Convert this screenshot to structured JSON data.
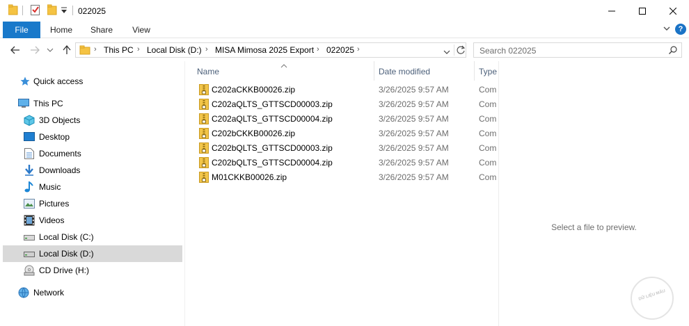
{
  "window": {
    "title": "022025",
    "controls": [
      "minimize",
      "maximize",
      "close"
    ]
  },
  "ribbon": {
    "tabs": [
      "File",
      "Home",
      "Share",
      "View"
    ]
  },
  "address": {
    "crumbs": [
      "This PC",
      "Local Disk (D:)",
      "MISA Mimosa 2025 Export",
      "022025"
    ]
  },
  "search": {
    "placeholder": "Search 022025"
  },
  "nav": {
    "items": [
      {
        "label": "Quick access",
        "icon": "star-icon"
      },
      {
        "label": "This PC",
        "icon": "computer-icon"
      },
      {
        "label": "3D Objects",
        "icon": "3d-objects-icon"
      },
      {
        "label": "Desktop",
        "icon": "desktop-icon"
      },
      {
        "label": "Documents",
        "icon": "documents-icon"
      },
      {
        "label": "Downloads",
        "icon": "downloads-icon"
      },
      {
        "label": "Music",
        "icon": "music-icon"
      },
      {
        "label": "Pictures",
        "icon": "pictures-icon"
      },
      {
        "label": "Videos",
        "icon": "videos-icon"
      },
      {
        "label": "Local Disk (C:)",
        "icon": "drive-icon"
      },
      {
        "label": "Local Disk (D:)",
        "icon": "drive-icon",
        "selected": true
      },
      {
        "label": "CD Drive (H:)",
        "icon": "cd-drive-icon"
      },
      {
        "label": "Network",
        "icon": "network-icon"
      }
    ]
  },
  "columns": {
    "name": "Name",
    "date": "Date modified",
    "type": "Type"
  },
  "files": [
    {
      "name": "C202aCKKB00026.zip",
      "date": "3/26/2025 9:57 AM",
      "type": "Com"
    },
    {
      "name": "C202aQLTS_GTTSCD00003.zip",
      "date": "3/26/2025 9:57 AM",
      "type": "Com"
    },
    {
      "name": "C202aQLTS_GTTSCD00004.zip",
      "date": "3/26/2025 9:57 AM",
      "type": "Com"
    },
    {
      "name": "C202bCKKB00026.zip",
      "date": "3/26/2025 9:57 AM",
      "type": "Com"
    },
    {
      "name": "C202bQLTS_GTTSCD00003.zip",
      "date": "3/26/2025 9:57 AM",
      "type": "Com"
    },
    {
      "name": "C202bQLTS_GTTSCD00004.zip",
      "date": "3/26/2025 9:57 AM",
      "type": "Com"
    },
    {
      "name": "M01CKKB00026.zip",
      "date": "3/26/2025 9:57 AM",
      "type": "Com"
    }
  ],
  "preview": {
    "message": "Select a file to preview."
  },
  "watermark": {
    "text": "DỮ LIỆU MẪU"
  },
  "colors": {
    "accent": "#1979ca",
    "folder": "#f5c343",
    "selected_bg": "#d9d9d9",
    "header_text": "#4c607a"
  }
}
